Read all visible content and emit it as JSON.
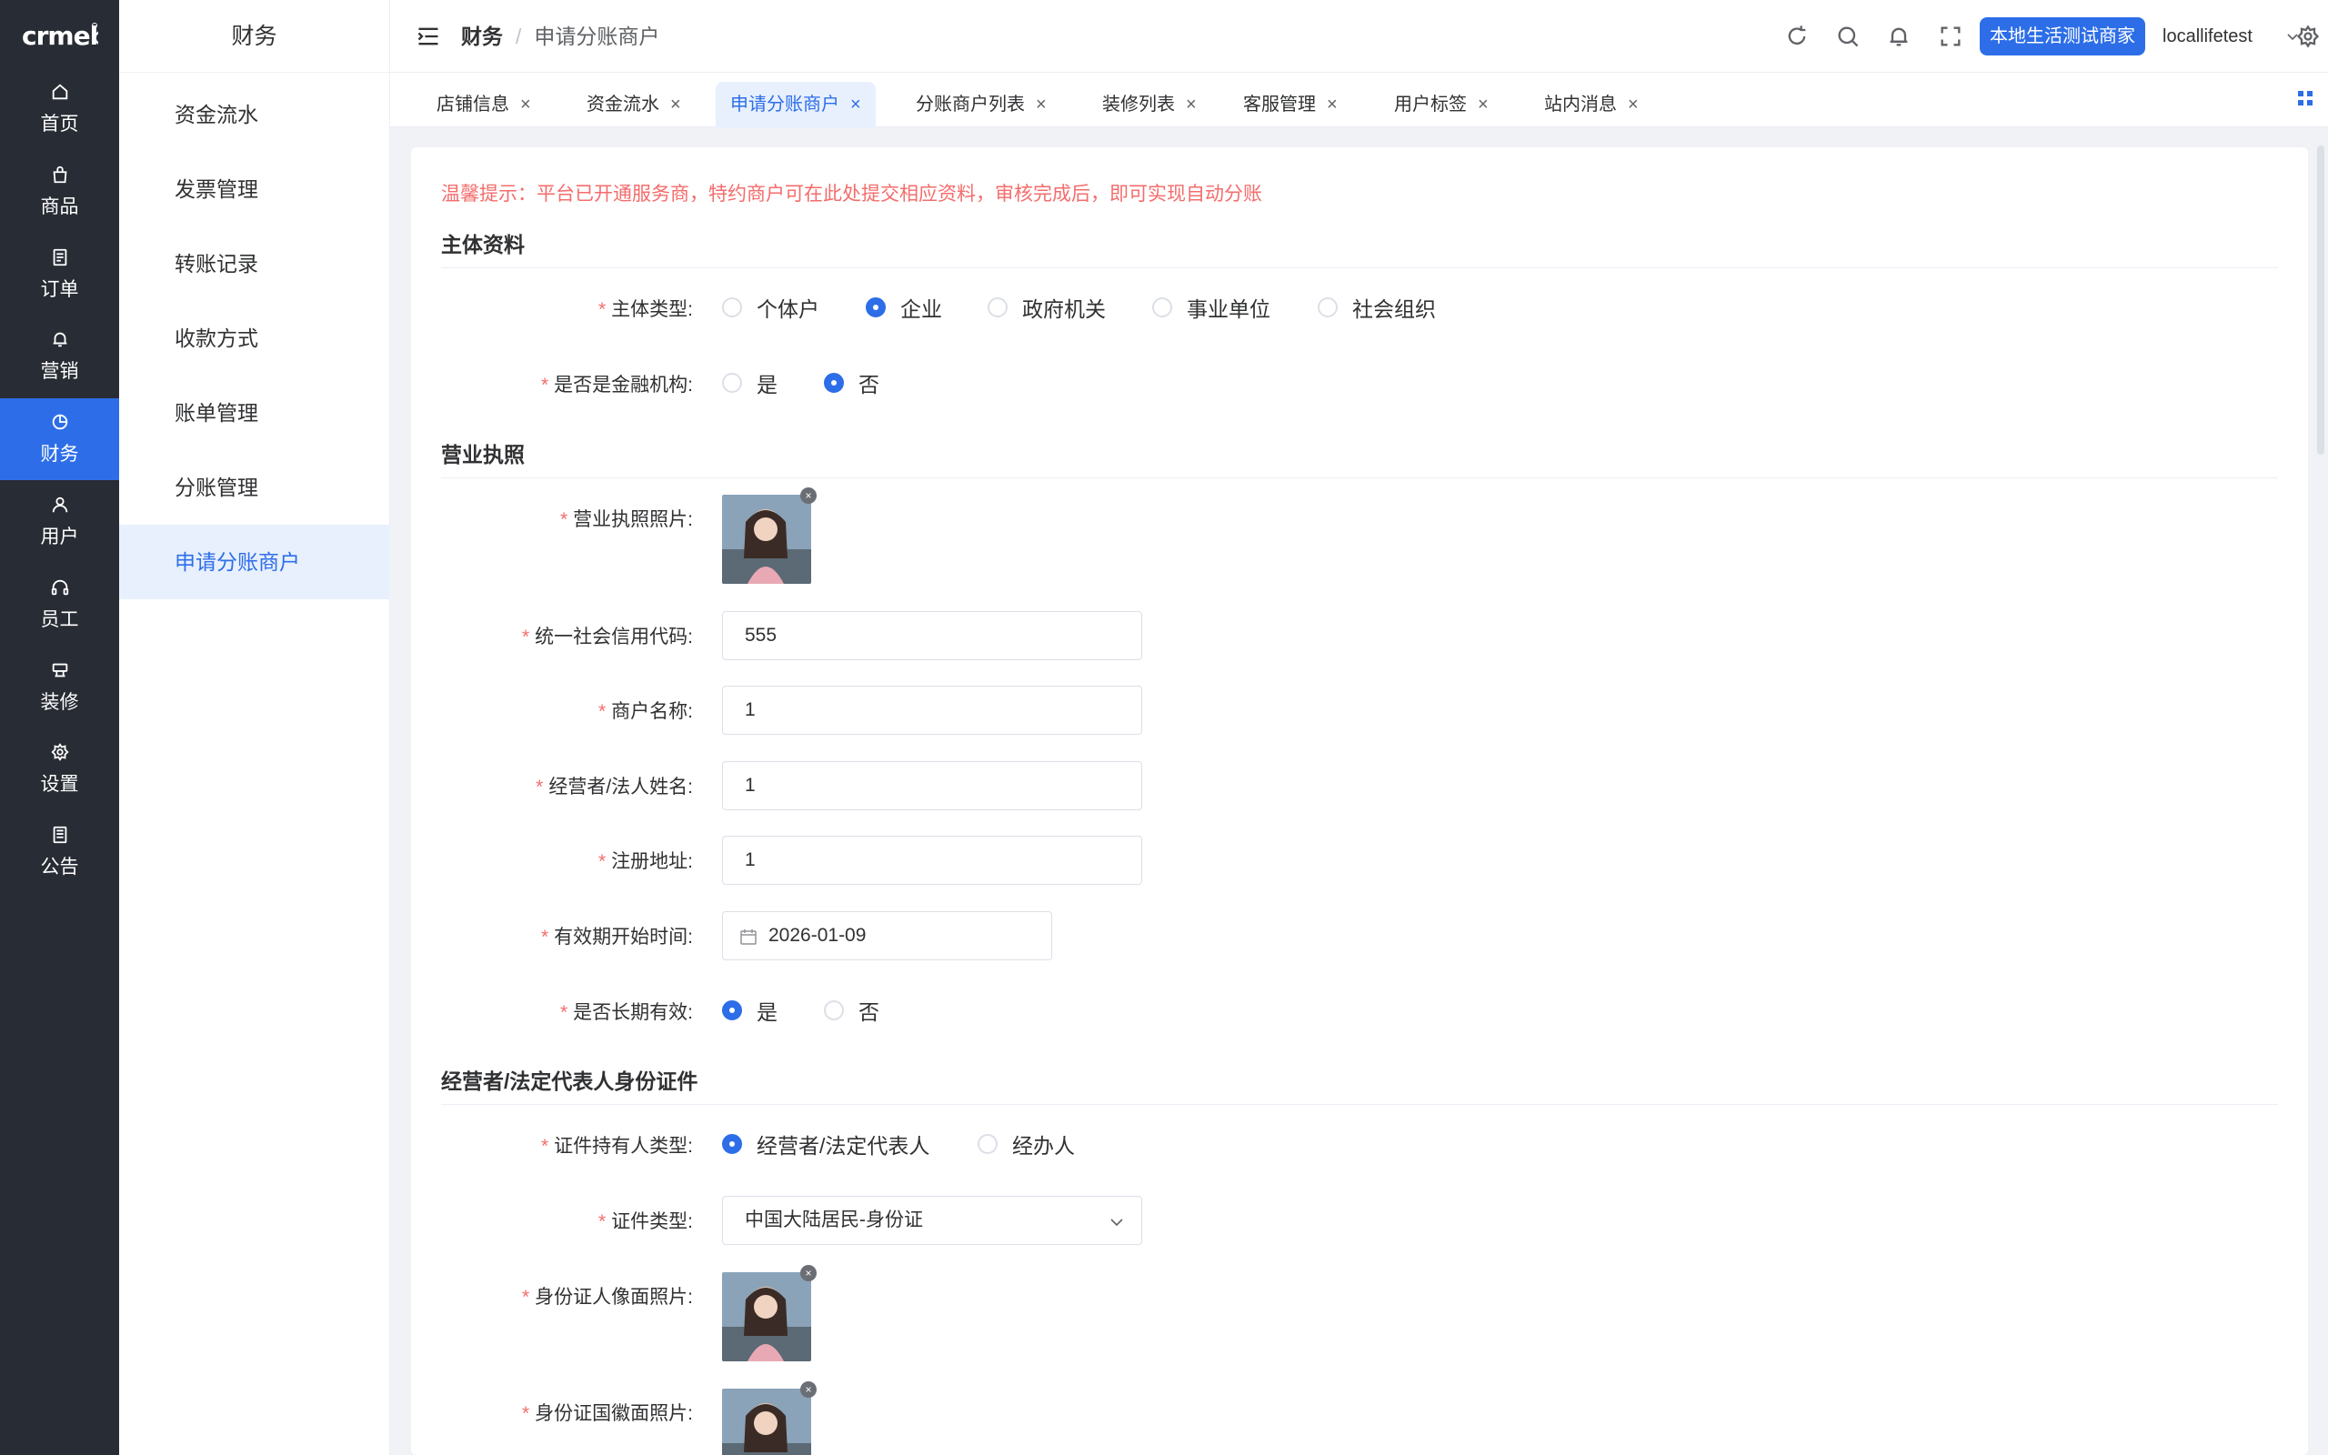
{
  "brand": {
    "logo_text": "crmeb",
    "accent": "#2d6ee8",
    "rail_bg": "#282c34"
  },
  "rail": [
    {
      "label": "首页",
      "icon": "home-icon"
    },
    {
      "label": "商品",
      "icon": "bag-icon"
    },
    {
      "label": "订单",
      "icon": "order-icon"
    },
    {
      "label": "营销",
      "icon": "bell-icon"
    },
    {
      "label": "财务",
      "icon": "finance-icon",
      "active": true
    },
    {
      "label": "用户",
      "icon": "user-icon"
    },
    {
      "label": "员工",
      "icon": "headset-icon"
    },
    {
      "label": "装修",
      "icon": "decor-icon"
    },
    {
      "label": "设置",
      "icon": "gear-icon"
    },
    {
      "label": "公告",
      "icon": "notice-icon"
    }
  ],
  "subnav": {
    "title": "财务",
    "items": [
      "资金流水",
      "发票管理",
      "转账记录",
      "收款方式",
      "账单管理",
      "分账管理",
      "申请分账商户"
    ],
    "active_index": 6
  },
  "header": {
    "breadcrumb_root": "财务",
    "breadcrumb_sep": "/",
    "breadcrumb_current": "申请分账商户",
    "shop_button": "本地生活测试商家",
    "user": "locallifetest"
  },
  "tabs": [
    "店铺信息",
    "资金流水",
    "申请分账商户",
    "分账商户列表",
    "装修列表",
    "客服管理",
    "用户标签",
    "站内消息"
  ],
  "tab_close": "×",
  "form": {
    "tip": "温馨提示：平台已开通服务商，特约商户可在此处提交相应资料，审核完成后，即可实现自动分账",
    "required_mark": "*",
    "section_subject": "主体资料",
    "subject_type_label": "主体类型:",
    "subject_type_options": [
      "个体户",
      "企业",
      "政府机关",
      "事业单位",
      "社会组织"
    ],
    "subject_type_selected": "企业",
    "financial_label": "是否是金融机构:",
    "financial_options": [
      "是",
      "否"
    ],
    "financial_selected": "否",
    "section_license": "营业执照",
    "license_photo_label": "营业执照照片:",
    "credit_code_label": "统一社会信用代码:",
    "credit_code_value": "555",
    "merchant_name_label": "商户名称:",
    "merchant_name_value": "1",
    "legal_name_label": "经营者/法人姓名:",
    "legal_name_value": "1",
    "reg_address_label": "注册地址:",
    "reg_address_value": "1",
    "valid_start_label": "有效期开始时间:",
    "valid_start_value": "2026-01-09",
    "long_term_label": "是否长期有效:",
    "long_term_options": [
      "是",
      "否"
    ],
    "long_term_selected": "是",
    "section_id": "经营者/法定代表人身份证件",
    "holder_type_label": "证件持有人类型:",
    "holder_type_options": [
      "经营者/法定代表人",
      "经办人"
    ],
    "holder_type_selected": "经营者/法定代表人",
    "id_type_label": "证件类型:",
    "id_type_value": "中国大陆居民-身份证",
    "id_front_label": "身份证人像面照片:",
    "id_back_label": "身份证国徽面照片:"
  }
}
